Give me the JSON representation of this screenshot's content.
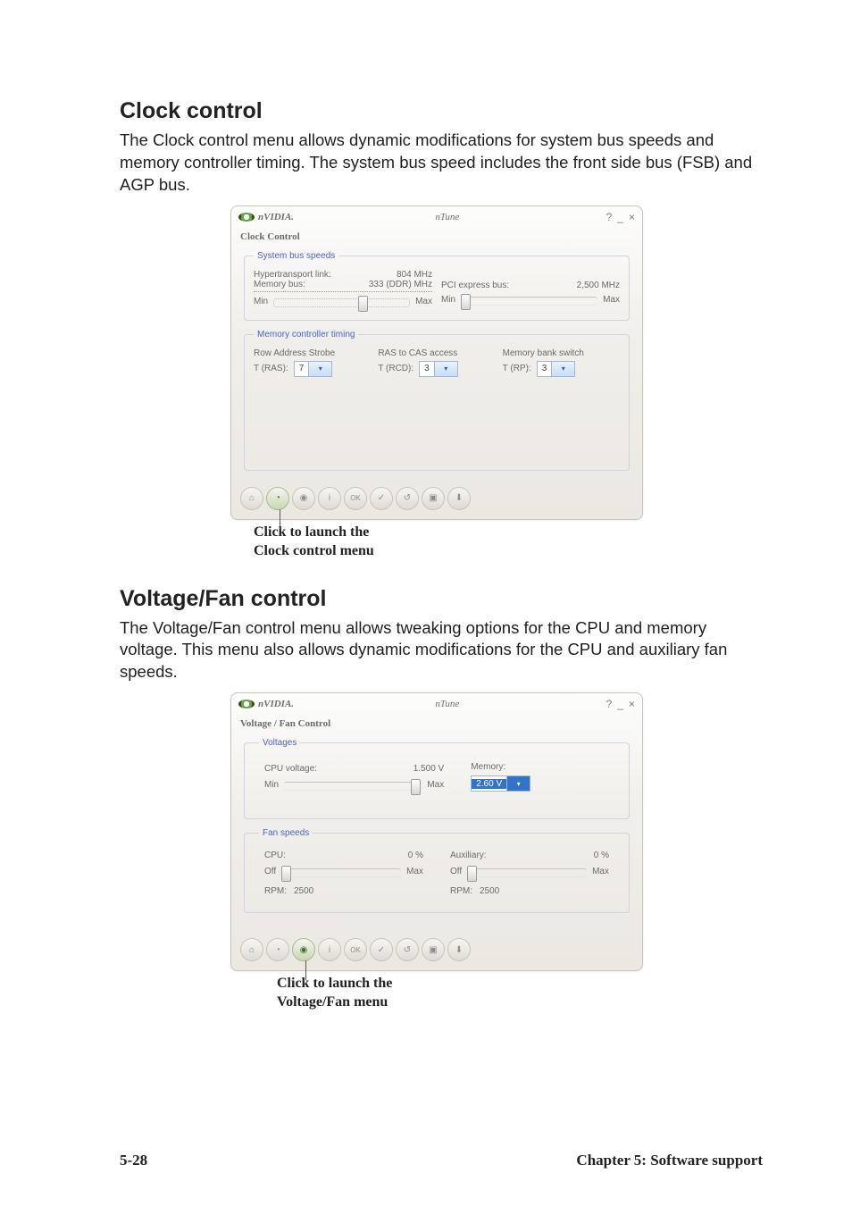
{
  "section1": {
    "heading": "Clock control",
    "paragraph": "The Clock control menu allows dynamic modifications for system bus speeds and memory controller timing. The system bus speed includes the front side bus (FSB) and AGP bus.",
    "caption_line1": "Click to launch the",
    "caption_line2": "Clock control menu"
  },
  "app1": {
    "brand": "nVIDIA.",
    "title": "nTune",
    "help": "?",
    "min": "_",
    "close": "×",
    "subtitle": "Clock Control",
    "group1": {
      "legend": "System bus speeds",
      "ht_label": "Hypertransport link:",
      "ht_value": "804 MHz",
      "mem_label": "Memory bus:",
      "mem_value": "333 (DDR) MHz",
      "pci_label": "PCI express bus:",
      "pci_value": "2,500 MHz",
      "min": "Min",
      "max": "Max"
    },
    "group2": {
      "legend": "Memory controller timing",
      "ras_label": "Row Address Strobe",
      "tras_label": "T (RAS):",
      "tras_value": "7",
      "rcd_label": "RAS to CAS access",
      "trcd_label": "T (RCD):",
      "trcd_value": "3",
      "bank_label": "Memory bank switch",
      "trp_label": "T (RP):",
      "trp_value": "3"
    }
  },
  "section2": {
    "heading": "Voltage/Fan control",
    "paragraph": "The Voltage/Fan control menu allows tweaking options for the CPU and memory voltage. This menu also allows dynamic modifications for the CPU and auxiliary fan speeds.",
    "caption_line1": "Click to launch the",
    "caption_line2": "Voltage/Fan menu"
  },
  "app2": {
    "brand": "nVIDIA.",
    "title": "nTune",
    "help": "?",
    "min": "_",
    "close": "×",
    "subtitle": "Voltage / Fan Control",
    "group1": {
      "legend": "Voltages",
      "cpu_label": "CPU voltage:",
      "cpu_value": "1.500 V",
      "mem_label": "Memory:",
      "mem_value": "2.60 V",
      "min": "Min",
      "max": "Max"
    },
    "group2": {
      "legend": "Fan speeds",
      "cpu_label": "CPU:",
      "cpu_pct": "0 %",
      "aux_label": "Auxiliary:",
      "aux_pct": "0 %",
      "off": "Off",
      "max": "Max",
      "rpm_label": "RPM:",
      "rpm1": "2500",
      "rpm2": "2500"
    }
  },
  "footer": {
    "page": "5-28",
    "chapter": "Chapter 5: Software support"
  },
  "icons": {
    "home": "⌂",
    "clock": "◔",
    "fan": "◉",
    "info": "i",
    "ok": "OK",
    "check": "✓",
    "back": "↺",
    "save": "▣",
    "load": "⬇"
  }
}
